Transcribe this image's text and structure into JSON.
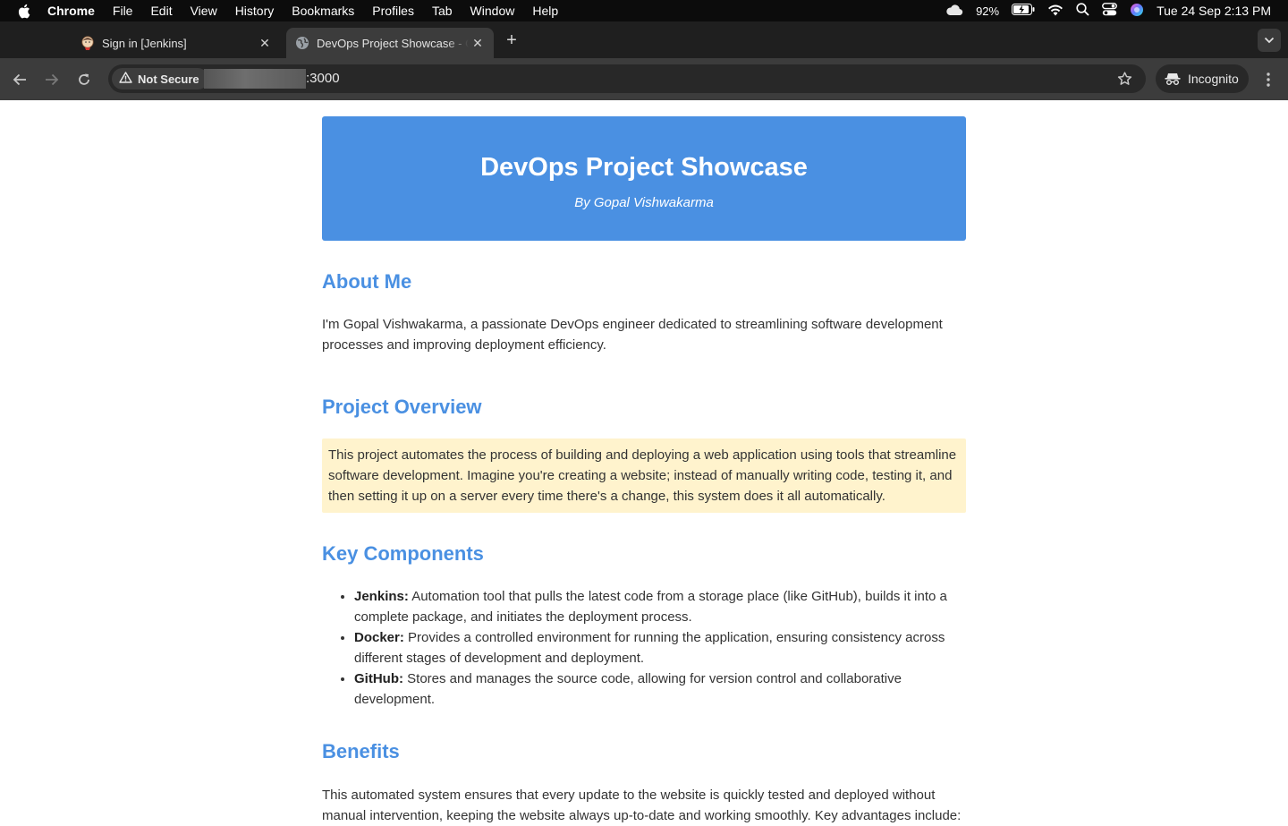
{
  "menubar": {
    "app": "Chrome",
    "items": [
      "File",
      "Edit",
      "View",
      "History",
      "Bookmarks",
      "Profiles",
      "Tab",
      "Window",
      "Help"
    ],
    "battery": "92%",
    "clock": "Tue 24 Sep  2:13 PM"
  },
  "tabs": [
    {
      "title": "Sign in [Jenkins]",
      "active": false
    },
    {
      "title": "DevOps Project Showcase - G",
      "active": true
    }
  ],
  "toolbar": {
    "security_chip": "Not Secure",
    "url_suffix": ":3000",
    "incognito_label": "Incognito"
  },
  "page": {
    "title": "DevOps Project Showcase",
    "byline": "By Gopal Vishwakarma",
    "about": {
      "heading": "About Me",
      "text": "I'm Gopal Vishwakarma, a passionate DevOps engineer dedicated to streamlining software development processes and improving deployment efficiency."
    },
    "overview": {
      "heading": "Project Overview",
      "text": "This project automates the process of building and deploying a web application using tools that streamline software development. Imagine you're creating a website; instead of manually writing code, testing it, and then setting it up on a server every time there's a change, this system does it all automatically."
    },
    "components": {
      "heading": "Key Components",
      "items": [
        {
          "name": "Jenkins:",
          "text": " Automation tool that pulls the latest code from a storage place (like GitHub), builds it into a complete package, and initiates the deployment process."
        },
        {
          "name": "Docker:",
          "text": " Provides a controlled environment for running the application, ensuring consistency across different stages of development and deployment."
        },
        {
          "name": "GitHub:",
          "text": " Stores and manages the source code, allowing for version control and collaborative development."
        }
      ]
    },
    "benefits": {
      "heading": "Benefits",
      "text": "This automated system ensures that every update to the website is quickly tested and deployed without manual intervention, keeping the website always up-to-date and working smoothly. Key advantages include:"
    }
  },
  "colors": {
    "accent": "#4a90e2",
    "highlight_bg": "#fff3cd",
    "text": "#333333"
  }
}
